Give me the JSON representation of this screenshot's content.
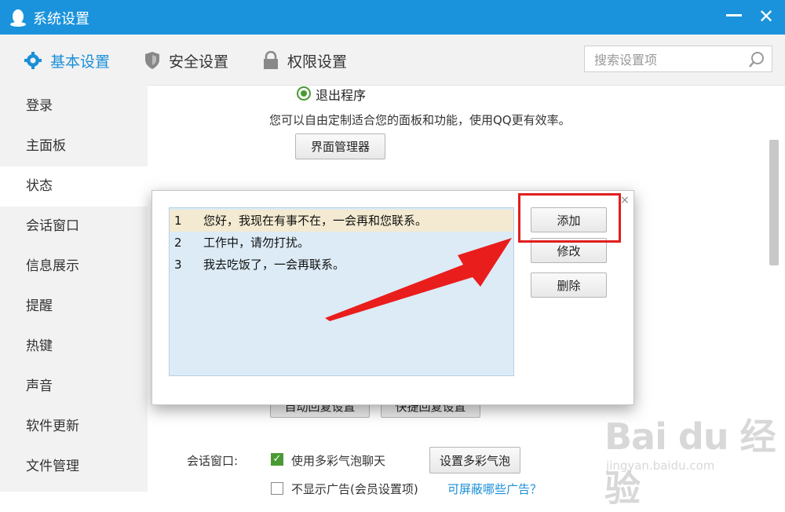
{
  "window": {
    "title": "系统设置"
  },
  "tabs": [
    {
      "label": "基本设置",
      "icon": "gear-icon"
    },
    {
      "label": "安全设置",
      "icon": "shield-icon"
    },
    {
      "label": "权限设置",
      "icon": "lock-icon"
    }
  ],
  "search": {
    "placeholder": "搜索设置项"
  },
  "sidebar": {
    "items": [
      {
        "label": "登录"
      },
      {
        "label": "主面板"
      },
      {
        "label": "状态"
      },
      {
        "label": "会话窗口"
      },
      {
        "label": "信息展示"
      },
      {
        "label": "提醒"
      },
      {
        "label": "热键"
      },
      {
        "label": "声音"
      },
      {
        "label": "软件更新"
      },
      {
        "label": "文件管理"
      }
    ],
    "active": "状态"
  },
  "main": {
    "exit_radio_label": "退出程序",
    "description": "您可以自由定制适合您的面板和功能，使用QQ更有效率。",
    "ui_manager_button": "界面管理器",
    "auto_reply_button": "自动回复设置",
    "quick_reply_button": "快捷回复设置",
    "chat_window_label": "会话窗口:",
    "bubble_checkbox_label": "使用多彩气泡聊天",
    "bubble_setting_button": "设置多彩气泡",
    "ad_checkbox_label": "不显示广告(会员设置项)",
    "ad_link": "可屏蔽哪些广告？"
  },
  "dialog": {
    "replies": [
      {
        "num": "1",
        "text": "您好，我现在有事不在，一会再和您联系。"
      },
      {
        "num": "2",
        "text": "工作中，请勿打扰。"
      },
      {
        "num": "3",
        "text": "我去吃饭了，一会再联系。"
      }
    ],
    "add_button": "添加",
    "edit_button": "修改",
    "delete_button": "删除",
    "close_symbol": "×"
  },
  "colors": {
    "titlebar": "#1a93dc",
    "accent": "#1a8fd9",
    "highlight_red": "#e11e1e",
    "selected_row": "#f3ead1",
    "list_bg": "#dcebf6"
  },
  "watermark": {
    "logo": "Bai du 经验",
    "url": "jingyan.baidu.com"
  }
}
